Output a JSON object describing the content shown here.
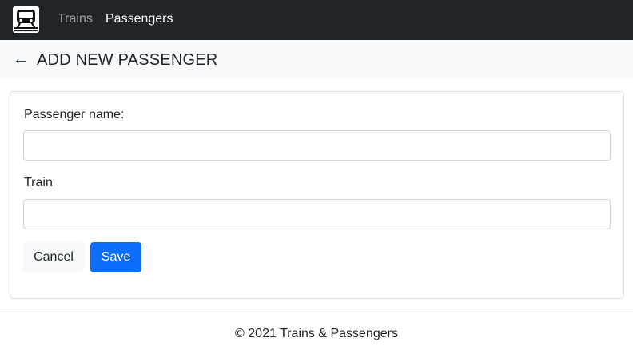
{
  "navbar": {
    "brand_icon": "train-icon",
    "links": [
      {
        "label": "Trains"
      },
      {
        "label": "Passengers"
      }
    ]
  },
  "header": {
    "back_icon": "←",
    "title": "ADD NEW PASSENGER"
  },
  "form": {
    "passenger_name_label": "Passenger name:",
    "passenger_name_value": "",
    "train_label": "Train",
    "train_value": "",
    "cancel_label": "Cancel",
    "save_label": "Save"
  },
  "footer": {
    "text": "© 2021 Trains & Passengers"
  },
  "colors": {
    "navbar_bg": "#212529",
    "primary": "#0d6efd",
    "header_bg": "#f8f9fa"
  }
}
